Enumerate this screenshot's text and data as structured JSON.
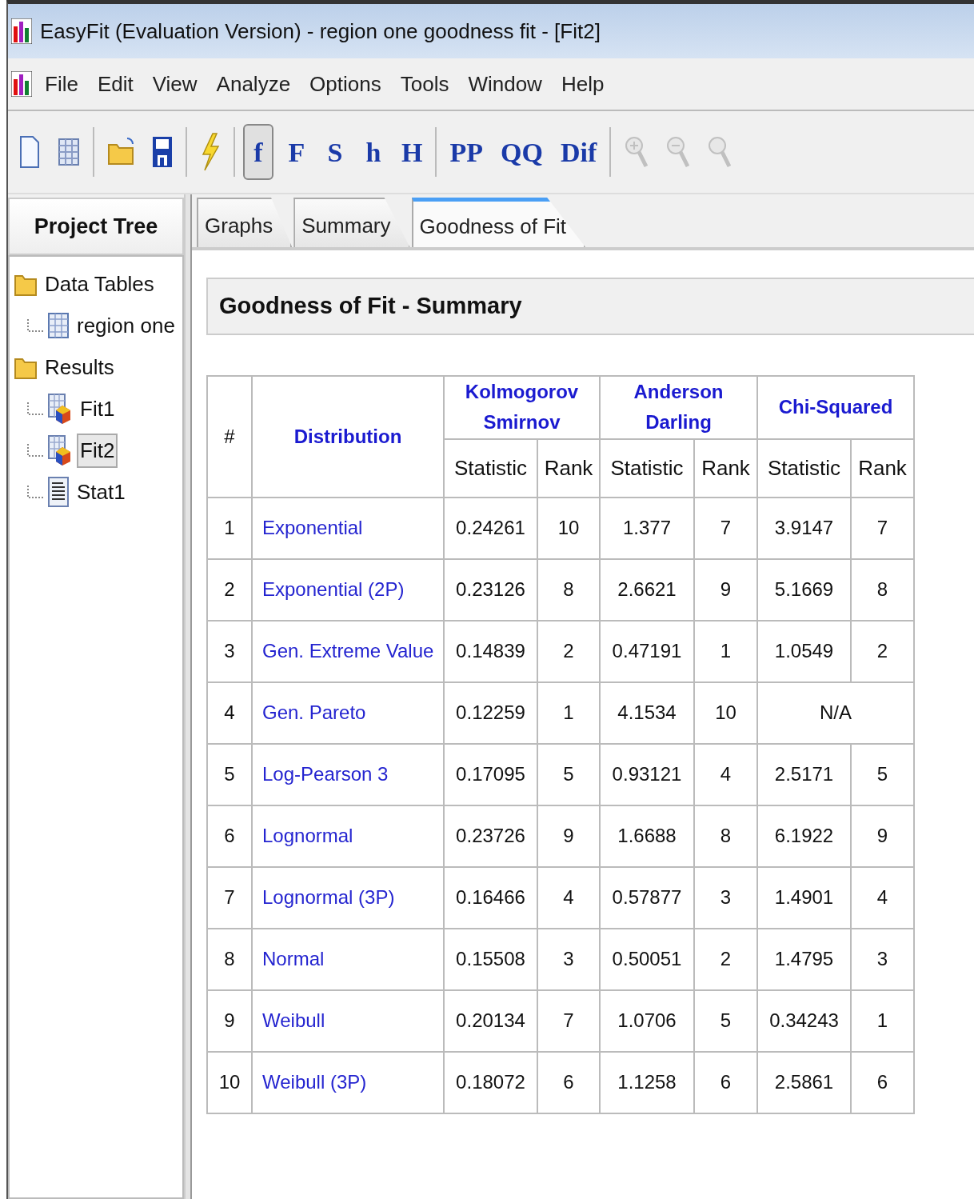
{
  "window": {
    "title": "EasyFit (Evaluation Version) - region one goodness fit - [Fit2]"
  },
  "menu": [
    "File",
    "Edit",
    "View",
    "Analyze",
    "Options",
    "Tools",
    "Window",
    "Help"
  ],
  "toolbar": [
    {
      "kind": "icon",
      "pressed": false,
      "disabled": false
    },
    {
      "kind": "icon",
      "pressed": false,
      "disabled": false
    },
    {
      "kind": "separator"
    },
    {
      "kind": "icon",
      "pressed": false,
      "disabled": false
    },
    {
      "kind": "icon",
      "pressed": false,
      "disabled": false
    },
    {
      "kind": "separator"
    },
    {
      "kind": "icon",
      "pressed": false,
      "disabled": false
    },
    {
      "kind": "separator"
    },
    {
      "kind": "text",
      "label": "f",
      "pressed": true,
      "disabled": false
    },
    {
      "kind": "text",
      "label": "F",
      "pressed": false,
      "disabled": false
    },
    {
      "kind": "text",
      "label": "S",
      "pressed": false,
      "disabled": false
    },
    {
      "kind": "text",
      "label": "h",
      "pressed": false,
      "disabled": false
    },
    {
      "kind": "text",
      "label": "H",
      "pressed": false,
      "disabled": false
    },
    {
      "kind": "separator"
    },
    {
      "kind": "text",
      "label": "PP",
      "pressed": false,
      "disabled": false
    },
    {
      "kind": "text",
      "label": "QQ",
      "pressed": false,
      "disabled": false
    },
    {
      "kind": "text",
      "label": "Dif",
      "pressed": false,
      "disabled": false
    },
    {
      "kind": "separator"
    },
    {
      "kind": "icon",
      "pressed": false,
      "disabled": true
    },
    {
      "kind": "icon",
      "pressed": false,
      "disabled": true
    },
    {
      "kind": "icon",
      "pressed": false,
      "disabled": true
    }
  ],
  "sidebar": {
    "title": "Project Tree",
    "items": [
      {
        "label": "Data Tables",
        "selected": false,
        "children": [
          {
            "label": "region one",
            "selected": false
          }
        ]
      },
      {
        "label": "Results",
        "selected": false,
        "children": [
          {
            "label": "Fit1",
            "selected": false
          },
          {
            "label": "Fit2",
            "selected": true
          },
          {
            "label": "Stat1",
            "selected": false
          }
        ]
      }
    ]
  },
  "tabs": [
    {
      "label": "Graphs",
      "selected": false
    },
    {
      "label": "Summary",
      "selected": false
    },
    {
      "label": "Goodness of Fit",
      "selected": true
    }
  ],
  "panel_title": "Goodness of Fit - Summary",
  "table": {
    "index_header": "#",
    "distribution_header": "Distribution",
    "test_groups": [
      {
        "title": "Kolmogorov Smirnov",
        "columns": [
          "Statistic",
          "Rank"
        ]
      },
      {
        "title": "Anderson Darling",
        "columns": [
          "Statistic",
          "Rank"
        ]
      },
      {
        "title": "Chi-Squared",
        "columns": [
          "Statistic",
          "Rank"
        ]
      }
    ],
    "rows": [
      {
        "index": "1",
        "distribution": "Exponential",
        "tests": [
          [
            "0.24261",
            "10"
          ],
          [
            "1.377",
            "7"
          ],
          [
            "3.9147",
            "7"
          ]
        ]
      },
      {
        "index": "2",
        "distribution": "Exponential (2P)",
        "tests": [
          [
            "0.23126",
            "8"
          ],
          [
            "2.6621",
            "9"
          ],
          [
            "5.1669",
            "8"
          ]
        ]
      },
      {
        "index": "3",
        "distribution": "Gen. Extreme Value",
        "tests": [
          [
            "0.14839",
            "2"
          ],
          [
            "0.47191",
            "1"
          ],
          [
            "1.0549",
            "2"
          ]
        ]
      },
      {
        "index": "4",
        "distribution": "Gen. Pareto",
        "tests": [
          [
            "0.12259",
            "1"
          ],
          [
            "4.1534",
            "10"
          ],
          [
            "N/A"
          ]
        ]
      },
      {
        "index": "5",
        "distribution": "Log-Pearson 3",
        "tests": [
          [
            "0.17095",
            "5"
          ],
          [
            "0.93121",
            "4"
          ],
          [
            "2.5171",
            "5"
          ]
        ]
      },
      {
        "index": "6",
        "distribution": "Lognormal",
        "tests": [
          [
            "0.23726",
            "9"
          ],
          [
            "1.6688",
            "8"
          ],
          [
            "6.1922",
            "9"
          ]
        ]
      },
      {
        "index": "7",
        "distribution": "Lognormal (3P)",
        "tests": [
          [
            "0.16466",
            "4"
          ],
          [
            "0.57877",
            "3"
          ],
          [
            "1.4901",
            "4"
          ]
        ]
      },
      {
        "index": "8",
        "distribution": "Normal",
        "tests": [
          [
            "0.15508",
            "3"
          ],
          [
            "0.50051",
            "2"
          ],
          [
            "1.4795",
            "3"
          ]
        ]
      },
      {
        "index": "9",
        "distribution": "Weibull",
        "tests": [
          [
            "0.20134",
            "7"
          ],
          [
            "1.0706",
            "5"
          ],
          [
            "0.34243",
            "1"
          ]
        ]
      },
      {
        "index": "10",
        "distribution": "Weibull (3P)",
        "tests": [
          [
            "0.18072",
            "6"
          ],
          [
            "1.1258",
            "6"
          ],
          [
            "2.5861",
            "6"
          ]
        ]
      }
    ]
  }
}
